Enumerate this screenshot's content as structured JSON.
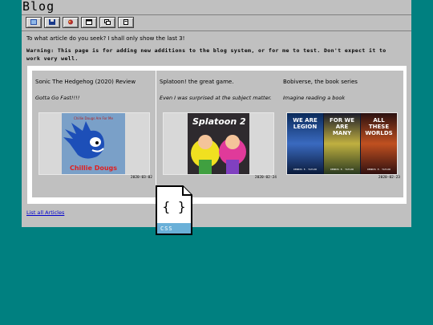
{
  "window": {
    "title": "Blog"
  },
  "toolbar": {
    "icons": [
      "image-icon",
      "save-icon",
      "paint-icon",
      "window-icon",
      "copy-icon",
      "document-icon"
    ]
  },
  "intro": "To what article do you seek? I shall only show the last 3!",
  "warning": "Warning: This page is for adding new additions to the blog system, or for me to test. Don't expect it to work very well.",
  "articles": [
    {
      "title": "Sonic The Hedgehog (2020) Review",
      "subtitle": "Gotta Go Fast!!!!",
      "date": "2020-03-02",
      "image_text": "Chillie Dougs",
      "image_caption": "Chillie Dougs Are For Me"
    },
    {
      "title": "Splatoon! the great game.",
      "subtitle": "Even I was surprised at the subject matter.",
      "date": "2020-02-24",
      "image_text": "Splatoon 2"
    },
    {
      "title": "Bobiverse, the book series",
      "subtitle": "Imagine reading a book",
      "date": "2020-02-23",
      "covers": [
        "WE ARE LEGION",
        "FOR WE ARE MANY",
        "ALL THESE WORLDS"
      ],
      "author": "DENNIS E. TAYLOR"
    }
  ],
  "links": {
    "list_all": "List all Articles"
  },
  "desktop_icon": {
    "label": "CSS",
    "glyph": "{ }"
  },
  "colors": {
    "desktop": "#008080",
    "window": "#c0c0c0",
    "link": "#0000cc"
  }
}
